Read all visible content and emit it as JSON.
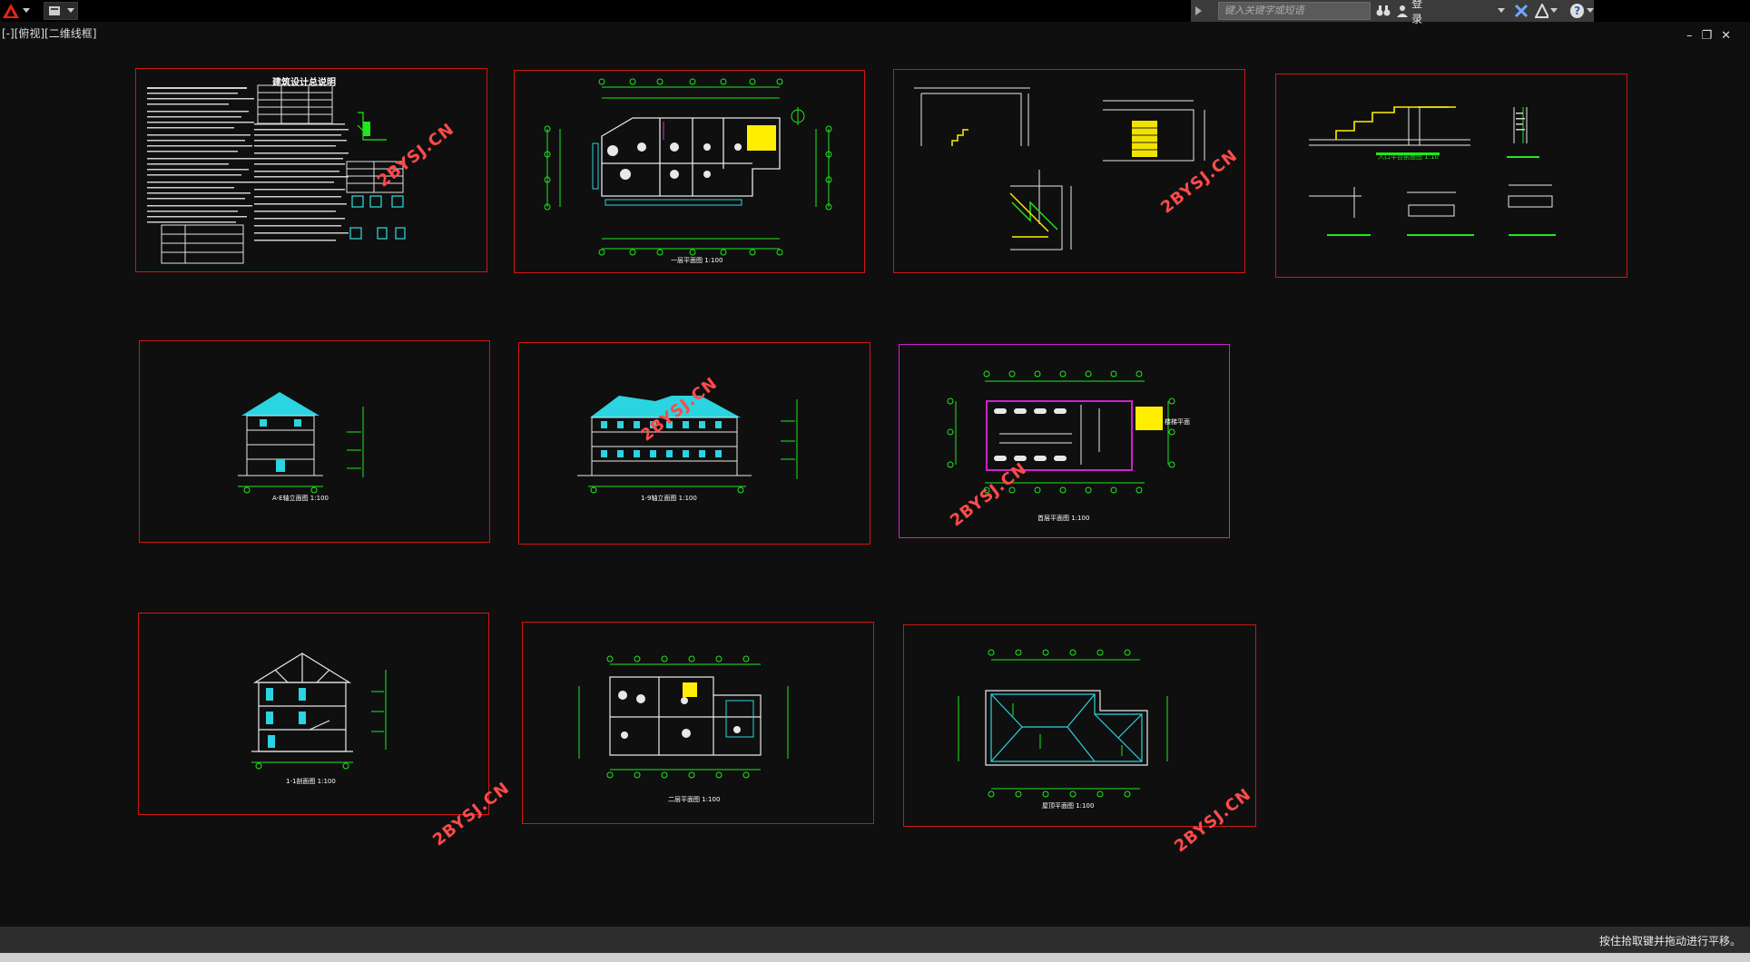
{
  "viewport_label": "[-][俯视][二维线框]",
  "search": {
    "placeholder": "键入关键字或短语"
  },
  "infocenter": {
    "login_label": "登录",
    "help_label": "?"
  },
  "status": {
    "message": "按住拾取键并拖动进行平移。"
  },
  "watermark": "2BYSJ.CN",
  "sheets": {
    "s1_title": "建筑设计总说明",
    "s2_title": "一层平面图 1:100",
    "s5_title": "A-E轴立面图 1:100",
    "s6_title": "1-9轴立面图 1:100",
    "s7_title": "首层平面图 1:100",
    "s7_note": "楼梯平面",
    "s8_title": "1-1剖面图 1:100",
    "s9_title": "二层平面图 1:100",
    "s10_title": "屋顶平面图 1:100",
    "s4_title": "入口平台剖面图 1:10"
  },
  "colors": {
    "background": "#0f0f0f",
    "sheet_border": "#d01616",
    "selected_border": "#d020d0",
    "green": "#1ee81e",
    "cyan": "#2ad4e0",
    "yellow": "#ffee00"
  }
}
